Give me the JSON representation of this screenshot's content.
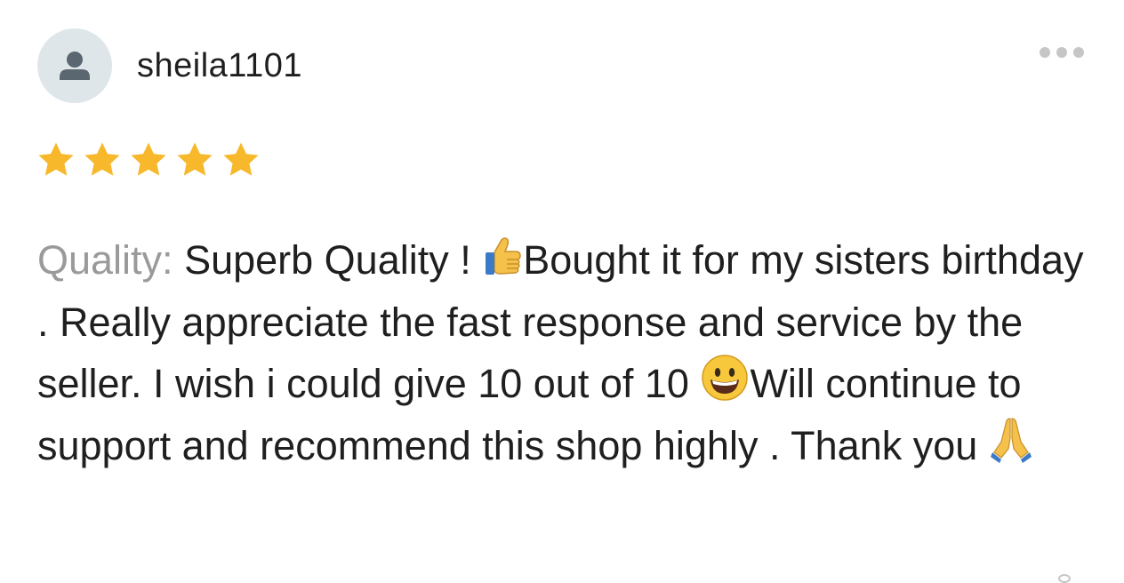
{
  "review": {
    "username": "sheila1101",
    "rating": 5,
    "rating_max": 5,
    "quality_label": "Quality:",
    "text_part1": " Superb Quality ! ",
    "text_part2": "Bought it for my sisters birthday . Really appreciate the fast response and service by the seller. I wish i could give 10 out of 10 ",
    "text_part3": "Will continue to support and recommend this shop highly . Thank you ",
    "emojis": [
      "thumbs-up-emoji",
      "grinning-face-emoji",
      "folded-hands-emoji"
    ]
  },
  "icons": {
    "avatar": "person-icon",
    "more": "more-options-icon",
    "star": "star-icon"
  },
  "colors": {
    "star": "#f7b82b",
    "label_gray": "#9a9a9a",
    "text": "#1f1f1f",
    "avatar_bg": "#dfe6ea",
    "avatar_fg": "#5a6670"
  }
}
